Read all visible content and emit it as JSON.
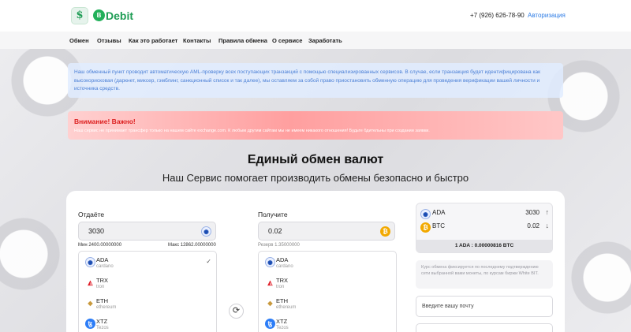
{
  "header": {
    "logo_mark": "$",
    "logo_badge": "B",
    "logo_text": "Debit",
    "phone": "+7 (926) 626-78-90",
    "auth_link": "Авторизация"
  },
  "nav": {
    "items": [
      "Обмен",
      "Отзывы",
      "Как это работает",
      "Контакты",
      "Правила обмена",
      "О сервисе",
      "Заработать"
    ]
  },
  "notices": {
    "info": "Наш обменный пункт проводит автоматическую AML-проверку всех поступающих транзакций с помощью специализированных сервисов. В случае, если транзакция будет идентифицирована как высокорисковая (даркнет, миксер, гэмблинг, санкционный список и так далее), мы оставляем за собой право приостановить обменную операцию для проведения верификации вашей личности и источника средств.",
    "warning_title": "Внимание! Важно!",
    "warning_text": "Наш сервис не принимает трансфер только на нашем сайте exchange.com. К любым другим сайтам мы не имеем никакого отношения! Будьте бдительны при создании заявки."
  },
  "hero": {
    "title": "Единый обмен валют",
    "subtitle": "Наш Сервис помогает производить обмены безопасно и быстро"
  },
  "give": {
    "label": "Отдаёте",
    "amount": "3030",
    "min": "Мин 2400.00000000",
    "max": "Макс 12862.00000000",
    "icon": "cardano-icon"
  },
  "receive": {
    "label": "Получите",
    "amount": "0.02",
    "reserve": "Резерв 1.35000000",
    "icon": "bitcoin-icon"
  },
  "currency_list": [
    {
      "code": "ADA",
      "network": "cardano",
      "icon": "cardano-icon"
    },
    {
      "code": "TRX",
      "network": "tron",
      "icon": "tron-icon"
    },
    {
      "code": "ETH",
      "network": "ethereum",
      "icon": "ethereum-icon"
    },
    {
      "code": "XTZ",
      "network": "Tezos",
      "icon": "tezos-icon"
    }
  ],
  "give_selected": "ADA",
  "summary": {
    "from_code": "ADA",
    "from_value": "3030",
    "to_code": "BTC",
    "to_value": "0.02",
    "rate": "1 ADA : 0.00000816 BTC"
  },
  "rate_note": "Курс обмена фиксируется по последнему подтверждению сети выбранной вами монеты, по курсам биржи White BIT.",
  "email": {
    "placeholder": "Введите вашу почту"
  },
  "colors": {
    "brand": "#1f9d55",
    "link": "#2c7be5",
    "warning": "#d22222",
    "btc": "#f2a900"
  }
}
